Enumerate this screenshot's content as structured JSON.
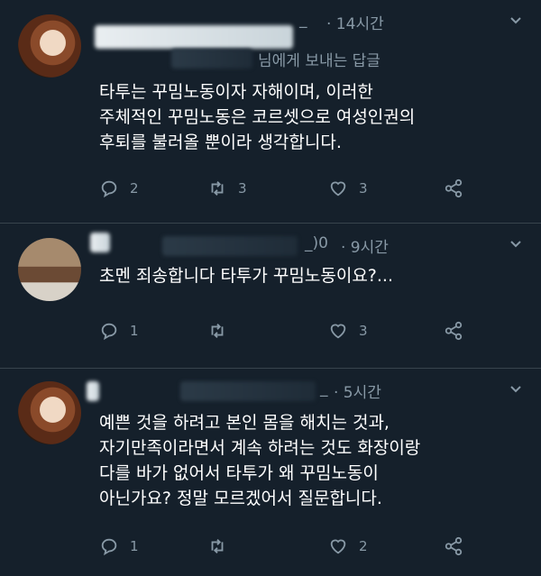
{
  "colors": {
    "background": "#15202b",
    "text": "#ffffff",
    "secondary_text": "#8899a6",
    "divider": "#38444d"
  },
  "tweets": [
    {
      "author_fragment": "_",
      "time": "· 14시간",
      "reply_to_suffix": "님에게 보내는 답글",
      "text": "타투는 꾸밈노동이자 자해이며, 이러한\n주체적인 꾸밈노동은 코르셋으로 여성인권의\n후퇴를 불러올 뿐이라 생각합니다.",
      "replies": "2",
      "retweets": "3",
      "likes": "3"
    },
    {
      "author_fragment": "_)0",
      "time": "· 9시간",
      "text": "초멘 죄송합니다 타투가 꾸밈노동이요?...",
      "replies": "1",
      "retweets": "",
      "likes": "3"
    },
    {
      "author_fragment": "_",
      "time": "· 5시간",
      "text": "예쁜 것을 하려고 본인 몸을 해치는 것과,\n자기만족이라면서 계속 하려는 것도 화장이랑\n다를 바가 없어서 타투가 왜 꾸밈노동이\n아닌가요? 정말 모르겠어서 질문합니다.",
      "replies": "1",
      "retweets": "",
      "likes": "2"
    }
  ],
  "icons": {
    "more": "chevron-down-icon",
    "reply": "reply-icon",
    "retweet": "retweet-icon",
    "like": "heart-icon",
    "share": "share-icon"
  }
}
